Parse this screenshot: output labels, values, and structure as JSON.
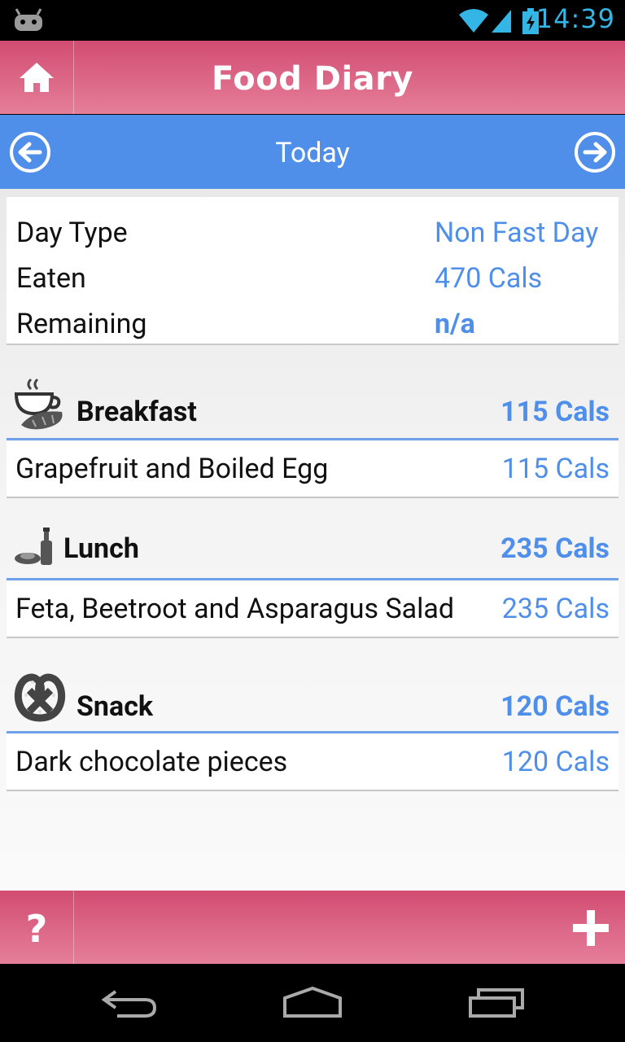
{
  "status_bar": {
    "time": "14:39",
    "icons": [
      "android-notification-icon",
      "wifi-icon",
      "signal-icon",
      "battery-charging-icon"
    ]
  },
  "app_bar": {
    "title": "Food Diary",
    "home_icon": "home-icon"
  },
  "date_nav": {
    "label": "Today",
    "prev_icon": "arrow-left-circle-icon",
    "next_icon": "arrow-right-circle-icon"
  },
  "summary": {
    "rows": [
      {
        "label": "Day Type",
        "value": "Non Fast Day"
      },
      {
        "label": "Eaten",
        "value": "470 Cals"
      },
      {
        "label": "Remaining",
        "value": "n/a"
      }
    ]
  },
  "meals": [
    {
      "name": "Breakfast",
      "icon": "coffee-croissant-icon",
      "total": "115 Cals",
      "items": [
        {
          "name": "Grapefruit and Boiled Egg",
          "cals": "115 Cals"
        }
      ]
    },
    {
      "name": "Lunch",
      "icon": "plate-bottle-icon",
      "total": "235 Cals",
      "items": [
        {
          "name": "Feta, Beetroot and Asparagus Salad",
          "cals": "235 Cals"
        }
      ]
    },
    {
      "name": "Snack",
      "icon": "pretzel-icon",
      "total": "120 Cals",
      "items": [
        {
          "name": "Dark chocolate pieces",
          "cals": "120 Cals"
        }
      ]
    }
  ],
  "bottom_bar": {
    "help_label": "?",
    "add_icon": "plus-icon"
  },
  "system_nav": {
    "icons": [
      "back-icon",
      "home-outline-icon",
      "recent-apps-icon"
    ]
  },
  "colors": {
    "accent_pink": "#d24c72",
    "accent_blue": "#4f8fea",
    "status_time": "#33b5e5"
  }
}
